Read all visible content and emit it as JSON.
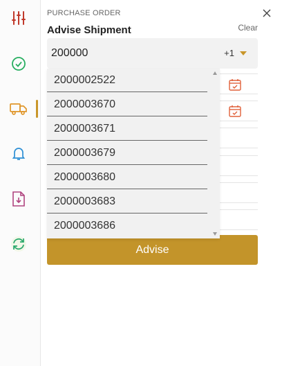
{
  "header": {
    "kicker": "PURCHASE ORDER",
    "title": "Advise Shipment",
    "clear_label": "Clear"
  },
  "combo": {
    "value": "200000",
    "extra_count": "+1"
  },
  "dropdown": {
    "options": [
      "2000002522",
      "2000003670",
      "2000003671",
      "2000003679",
      "2000003680",
      "2000003683",
      "2000003686"
    ]
  },
  "advise_label": "Advise",
  "colors": {
    "accent": "#c3942a",
    "active_rail": "#c9962a"
  }
}
